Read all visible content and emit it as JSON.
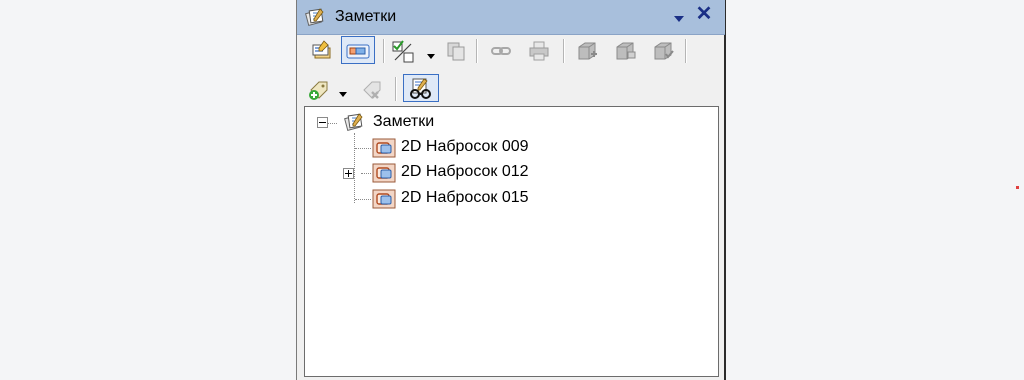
{
  "window": {
    "title": "Заметки",
    "title_icon": "notes-icon",
    "dropdown_icon": "chevron-down-icon",
    "close_label": "✕"
  },
  "toolbar": {
    "row1": [
      {
        "name": "properties-button",
        "icon": "properties-icon",
        "enabled": true,
        "active": false
      },
      {
        "name": "show-notes-button",
        "icon": "note-view-icon",
        "enabled": true,
        "active": true
      },
      {
        "name": "select-mode-button",
        "icon": "checkbox-select-icon",
        "enabled": true,
        "dropdown": true
      },
      {
        "name": "copy-button",
        "icon": "copy-icon",
        "enabled": false
      },
      {
        "name": "link-button",
        "icon": "link-icon",
        "enabled": false
      },
      {
        "name": "print-button",
        "icon": "printer-icon",
        "enabled": false
      },
      {
        "name": "box-add-button",
        "icon": "box-add-icon",
        "enabled": false
      },
      {
        "name": "box-edit-button",
        "icon": "box-edit-icon",
        "enabled": false
      },
      {
        "name": "box-check-button",
        "icon": "box-check-icon",
        "enabled": false
      }
    ],
    "row2": [
      {
        "name": "add-tag-button",
        "icon": "tag-add-icon",
        "enabled": true,
        "dropdown": true
      },
      {
        "name": "remove-tag-button",
        "icon": "tag-remove-icon",
        "enabled": false
      },
      {
        "name": "view-glasses-button",
        "icon": "glasses-icon",
        "enabled": true,
        "active": true
      }
    ]
  },
  "tree": {
    "root": {
      "label": "Заметки",
      "icon": "notes-icon",
      "expanded": true
    },
    "children": [
      {
        "label": "2D Набросок 009",
        "icon": "sketch-icon",
        "has_children": false
      },
      {
        "label": "2D Набросок 012",
        "icon": "sketch-icon",
        "has_children": true,
        "expanded": false
      },
      {
        "label": "2D Набросок 015",
        "icon": "sketch-icon",
        "has_children": false
      }
    ]
  },
  "colors": {
    "titlebar": "#a8bfdc",
    "close": "#1a2f86",
    "active_border": "#3a6fc4"
  }
}
